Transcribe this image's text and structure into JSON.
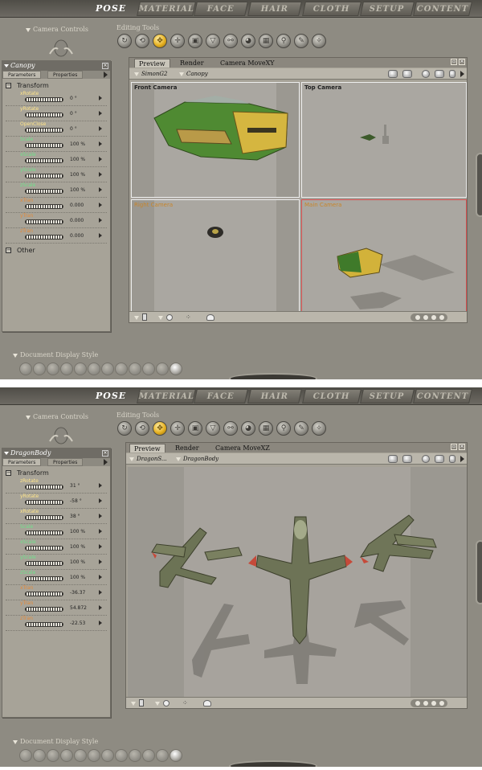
{
  "tabs": [
    "POSE",
    "MATERIAL",
    "FACE",
    "HAIR",
    "CLOTH",
    "SETUP",
    "CONTENT"
  ],
  "header": {
    "camera_controls": "Camera Controls",
    "editing_tools": "Editing Tools",
    "document_display_style": "Document Display Style"
  },
  "screen1": {
    "panel": {
      "title": "Canopy",
      "tab_parameters": "Parameters",
      "tab_properties": "Properties",
      "group_transform": "Transform",
      "group_other": "Other",
      "params": [
        {
          "name": "xRotate",
          "value": "0 °"
        },
        {
          "name": "yRotate",
          "value": "0 °"
        },
        {
          "name": "OpenClose",
          "value": "0 °"
        },
        {
          "name": "Scale",
          "value": "100 %"
        },
        {
          "name": "xScale",
          "value": "100 %"
        },
        {
          "name": "yScale",
          "value": "100 %"
        },
        {
          "name": "zScale",
          "value": "100 %"
        },
        {
          "name": "xTran",
          "value": "0.000"
        },
        {
          "name": "yTran",
          "value": "0.000"
        },
        {
          "name": "zTran",
          "value": "0.000"
        }
      ]
    },
    "preview": {
      "tab_preview": "Preview",
      "tab_render": "Render",
      "camera_label": "Camera MoveXY",
      "figure": "SimonG2",
      "actor": "Canopy",
      "views": {
        "front": "Front Camera",
        "top": "Top Camera",
        "right": "Right Camera",
        "main": "Main Camera"
      }
    }
  },
  "screen2": {
    "panel": {
      "title": "DragonBody",
      "tab_parameters": "Parameters",
      "tab_properties": "Properties",
      "group_transform": "Transform",
      "params": [
        {
          "name": "zRotate",
          "value": "31 °"
        },
        {
          "name": "yRotate",
          "value": "-58 °"
        },
        {
          "name": "xRotate",
          "value": "38 °"
        },
        {
          "name": "Scale",
          "value": "100 %"
        },
        {
          "name": "xScale",
          "value": "100 %"
        },
        {
          "name": "yScale",
          "value": "100 %"
        },
        {
          "name": "zScale",
          "value": "100 %"
        },
        {
          "name": "xTran",
          "value": "-36.37"
        },
        {
          "name": "yTran",
          "value": "54.872"
        },
        {
          "name": "zTran",
          "value": "-22.53"
        }
      ]
    },
    "preview": {
      "tab_preview": "Preview",
      "tab_render": "Render",
      "camera_label": "Camera MoveXZ",
      "figure": "DragonS...",
      "actor": "DragonBody"
    }
  },
  "colors": {
    "background": "#8e8b82",
    "panel": "#a7a398",
    "active_tool": "#e6b020",
    "main_camera_border": "#d74f4f",
    "param_highlight": "#ffe58a",
    "param_color_green": "#6fe08a",
    "param_color_orange": "#e38a3a"
  }
}
